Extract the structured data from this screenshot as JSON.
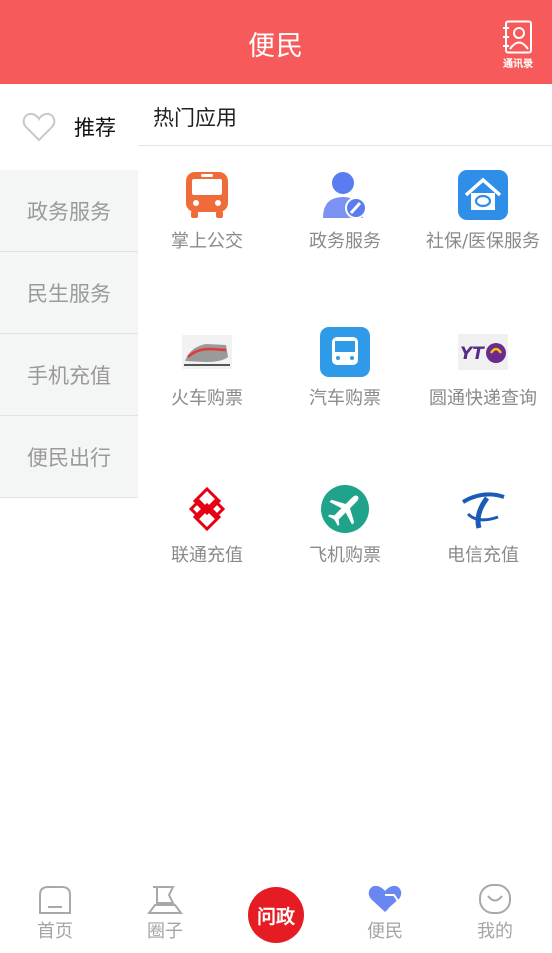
{
  "header": {
    "title": "便民",
    "contacts_label": "通讯录"
  },
  "sidebar": {
    "items": [
      {
        "label": "推荐",
        "active": true
      },
      {
        "label": "政务服务"
      },
      {
        "label": "民生服务"
      },
      {
        "label": "手机充值"
      },
      {
        "label": "便民出行"
      }
    ]
  },
  "main": {
    "section_title": "热门应用",
    "apps": [
      {
        "label": "掌上公交",
        "icon": "bus-icon"
      },
      {
        "label": "政务服务",
        "icon": "government-user-icon"
      },
      {
        "label": "社保/医保服务",
        "icon": "social-security-house-icon"
      },
      {
        "label": "火车购票",
        "icon": "train-icon"
      },
      {
        "label": "汽车购票",
        "icon": "coach-bus-icon"
      },
      {
        "label": "圆通快递查询",
        "icon": "yto-logo"
      },
      {
        "label": "联通充值",
        "icon": "china-unicom-logo"
      },
      {
        "label": "飞机购票",
        "icon": "airplane-icon"
      },
      {
        "label": "电信充值",
        "icon": "china-telecom-logo"
      }
    ]
  },
  "tabbar": {
    "items": [
      {
        "label": "首页",
        "icon": "home-icon"
      },
      {
        "label": "圈子",
        "icon": "circle-flag-icon"
      },
      {
        "label": "问政",
        "icon": "wenzheng-logo"
      },
      {
        "label": "便民",
        "icon": "heart-hand-icon",
        "active": true
      },
      {
        "label": "我的",
        "icon": "smile-face-icon"
      }
    ]
  },
  "colors": {
    "brand": "#f75a5a",
    "active_tab": "#f25a5a",
    "sidebar_bg": "#f4f5f5"
  }
}
